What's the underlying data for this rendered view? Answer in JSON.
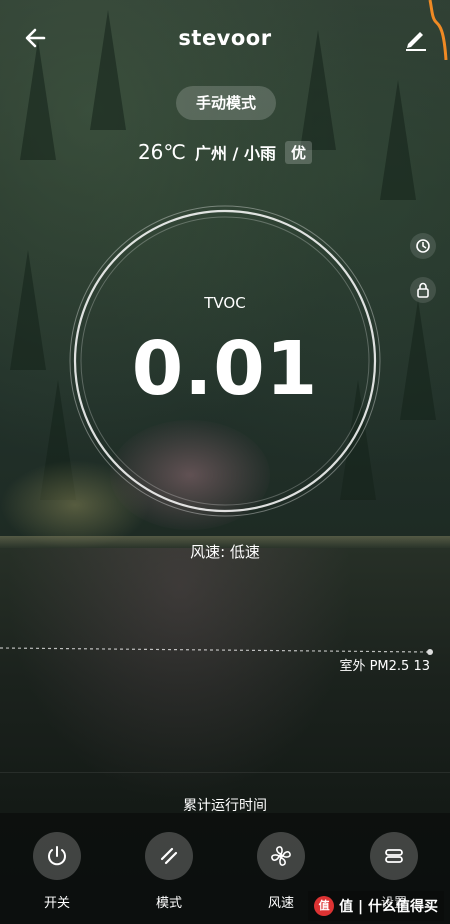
{
  "header": {
    "title": "stevoor"
  },
  "mode": {
    "label": "手动模式"
  },
  "weather": {
    "temp": "26℃",
    "city": "广州 / 小雨",
    "aqi": "优"
  },
  "gauge": {
    "label": "TVOC",
    "value": "0.01"
  },
  "status": {
    "fan_speed": "风速: 低速"
  },
  "outdoor": {
    "pm25": "室外 PM2.5 13"
  },
  "footer": {
    "runtime_label": "累计运行时间"
  },
  "controls": [
    {
      "label": "开关",
      "icon": "power-icon"
    },
    {
      "label": "模式",
      "icon": "mode-icon"
    },
    {
      "label": "风速",
      "icon": "fan-icon"
    },
    {
      "label": "设置",
      "icon": "settings-icon"
    }
  ],
  "watermark": {
    "text": "值 | 什么值得买"
  },
  "colors": {
    "accent_orange": "#f08a24"
  }
}
